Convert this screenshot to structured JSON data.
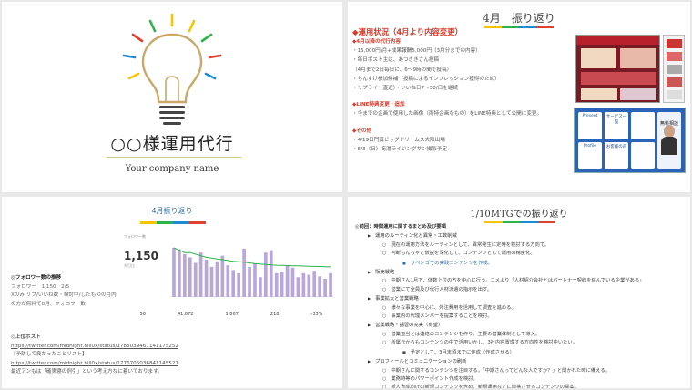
{
  "colors": {
    "accent_red": "#d93a2b",
    "link_blue": "#2e6fb3",
    "rainbow": [
      "#f6c400",
      "#2eb34a",
      "#1c8bd4",
      "#e0402d"
    ],
    "bulb_outline": "#c9a86a"
  },
  "slide1": {
    "title": "○○様運用代行",
    "subtitle": "Your company name",
    "icon": "light-bulb-icon"
  },
  "slide2": {
    "title": "4月　振り返り",
    "section1_head": "◆運用状況（4月より内容変更）",
    "section1_sub": "◆4月以降の代行内容",
    "section1_lines": [
      "・15,000円/月+成果報酬5,000円（3月分までの内容）",
      "・毎日ポスト主は、あつききさん投稿",
      "（4月まで2日毎日に、6〜9時の間で投稿）",
      "・ちんすけ参加候補（投稿によるインプレッション獲得のため）",
      "・リプライ（直近）・いいね日7〜30/日を継続"
    ],
    "section2_head": "◆LINE特典変更・追加",
    "section2_lines": [
      "・今までの企画で使用した画像（両特企画なもの）をLINE特典として公開に変更。"
    ],
    "section3_head": "◆その他",
    "section3_lines": [
      "・4/19日門真ビッグドリームス大阪出場",
      "・5/3（日）商湯ライジングサン撮影予定"
    ],
    "tile_labels": [
      "Present",
      "サービス一覧",
      "",
      "Profile",
      "お客様の声",
      "無料相談"
    ],
    "portrait_name": "無料相談"
  },
  "slide3": {
    "title": "4月振り返り",
    "kpi_label": "フォロワー数",
    "kpi_value": "1,150",
    "kpi_sub": "先月比",
    "stats": [
      "56",
      "41,672",
      "1,867",
      "218",
      "-33%"
    ],
    "chart_values": [
      620,
      600,
      540,
      500,
      430,
      560,
      470,
      380,
      450,
      520,
      400,
      340,
      300,
      610,
      380,
      420,
      250,
      560,
      590,
      300,
      320,
      400,
      370,
      250,
      300,
      280,
      330,
      260,
      230,
      300
    ],
    "chart_line": [
      620,
      590,
      560,
      560,
      540,
      520,
      500,
      490,
      480,
      470,
      460,
      450,
      445,
      440,
      430,
      420,
      415,
      410,
      405,
      400,
      398,
      396,
      394,
      392,
      390,
      388,
      386,
      384,
      382,
      380
    ],
    "body_head": "◎フォロワー数の推移",
    "body_lines": [
      "フォロワー　1,150　2/5",
      "Xのみ リプ/いいね数・検討中/したものの月内",
      "の方が無料で8月、フォロワー数"
    ],
    "posts_head": "◎上位ポスト",
    "post_links": [
      "https://twitter.com/midnight.hill0x/status/1783039467141175252",
      "https://twitter.com/midnight.hill0x/status/1776706036841145527"
    ],
    "post_notes": [
      "【予防して良かったことリスト】",
      "最近アンもは「確実寝の例引」という考え方なに着いております。"
    ]
  },
  "slide4": {
    "title": "1/10MTGでの振り返り",
    "items": [
      {
        "lvl": 0,
        "text": "◎前回：時間運用に関するまとめ及び要項"
      },
      {
        "lvl": 1,
        "text": "運用のルーティン化と異常・工数削減"
      },
      {
        "lvl": 2,
        "text": "現在の運用方法をルーティンとして、異常発生に定時を検討する方向で。"
      },
      {
        "lvl": 2,
        "text": "判断もんちゃと仮説を深化して、コンテンツとして運用の精度化。"
      },
      {
        "lvl": 3,
        "text": "リベンゴでの実践コンテンツを作成。",
        "blue": true
      },
      {
        "lvl": 1,
        "text": "販売戦略"
      },
      {
        "lvl": 2,
        "text": "中期さん1月下、体数上位の方を中心に行う。コメより「人材紹介会社とはパートナー契約を結んでいる企業がある」"
      },
      {
        "lvl": 2,
        "text": "営業にて全員及び代行人材派遣の指示を出す。"
      },
      {
        "lvl": 1,
        "text": "事業拡大と営業戦略"
      },
      {
        "lvl": 2,
        "text": "様々な事業を中心に、外注費用を活用して調査を進める。"
      },
      {
        "lvl": 2,
        "text": "事業内の代理メンバーを提案することを検討。"
      },
      {
        "lvl": 1,
        "text": "営業戦略・講習の充実（有望）"
      },
      {
        "lvl": 2,
        "text": "営業担当とは連絡のコンテンツを作り、主要の営業体制として導入。"
      },
      {
        "lvl": 2,
        "text": "所属元からもコンテンツの中で活用いかし、3社内容置理する方向性を検討中いたい。"
      },
      {
        "lvl": 3,
        "text": "予定として、3月末頃までに作成（作成させる）"
      },
      {
        "lvl": 1,
        "text": "プロフィールとコミュニケーションの刷新"
      },
      {
        "lvl": 2,
        "text": "中期さんに関するコンテンツを注目する。「中期さんってどんな人ですか？」と聞かれた時に備える。"
      },
      {
        "lvl": 2,
        "text": "業務時等のパワーポイント作成を検討。"
      },
      {
        "lvl": 2,
        "text": "新人育成向けの新規コンテンツを含め、新規運用などに連携させるコンテンツの提案。"
      }
    ]
  }
}
